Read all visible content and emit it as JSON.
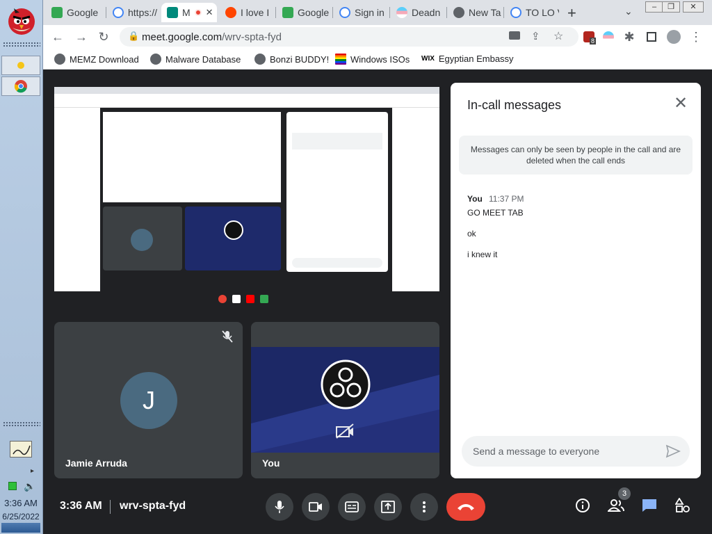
{
  "taskbar": {
    "time": "3:36 AM",
    "date": "6/25/2022"
  },
  "browser": {
    "tabs": [
      {
        "label": "Google",
        "color": "#34a853"
      },
      {
        "label": "https://",
        "color": "#4285f4"
      },
      {
        "label": "M",
        "color": "#00897b"
      },
      {
        "label": "I love I",
        "color": "#ff4500"
      },
      {
        "label": "Google",
        "color": "#34a853"
      },
      {
        "label": "Sign in",
        "color": "#4285f4"
      },
      {
        "label": "Deadn",
        "color": "#f48fb1"
      },
      {
        "label": "New Ta",
        "color": "#5f6368"
      },
      {
        "label": "TO LO V",
        "color": "#4285f4"
      }
    ],
    "url_domain": "meet.google.com",
    "url_path": "/wrv-spta-fyd",
    "extension_badge": "8",
    "bookmarks": [
      {
        "label": "MEMZ Download"
      },
      {
        "label": "Malware Database"
      },
      {
        "label": "Bonzi BUDDY!"
      },
      {
        "label": "Windows ISOs"
      },
      {
        "label": "Egyptian Embassy"
      }
    ]
  },
  "meet": {
    "participants": [
      {
        "name": "Jamie Arruda",
        "initial": "J"
      },
      {
        "name": "You"
      }
    ],
    "chat": {
      "title": "In-call messages",
      "notice": "Messages can only be seen by people in the call and are deleted when the call ends",
      "author": "You",
      "time": "11:37 PM",
      "messages": [
        "GO MEET TAB",
        "ok",
        "i knew it"
      ],
      "input_placeholder": "Send a message to everyone"
    },
    "controls": {
      "clock": "3:36 AM",
      "meeting_code": "wrv-spta-fyd",
      "people_count": "3"
    }
  }
}
